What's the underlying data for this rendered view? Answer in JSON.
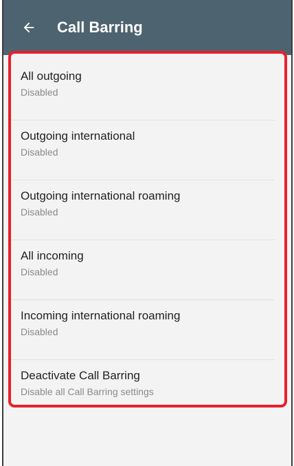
{
  "appbar": {
    "title": "Call Barring",
    "back_icon": "arrow-left-icon"
  },
  "items": [
    {
      "label": "All outgoing",
      "summary": "Disabled"
    },
    {
      "label": "Outgoing international",
      "summary": "Disabled"
    },
    {
      "label": "Outgoing international roaming",
      "summary": "Disabled"
    },
    {
      "label": "All incoming",
      "summary": "Disabled"
    },
    {
      "label": "Incoming international roaming",
      "summary": "Disabled"
    },
    {
      "label": "Deactivate Call Barring",
      "summary": "Disable all Call Barring settings"
    }
  ],
  "colors": {
    "appbar": "#4d6370",
    "highlight": "#e8202a"
  }
}
